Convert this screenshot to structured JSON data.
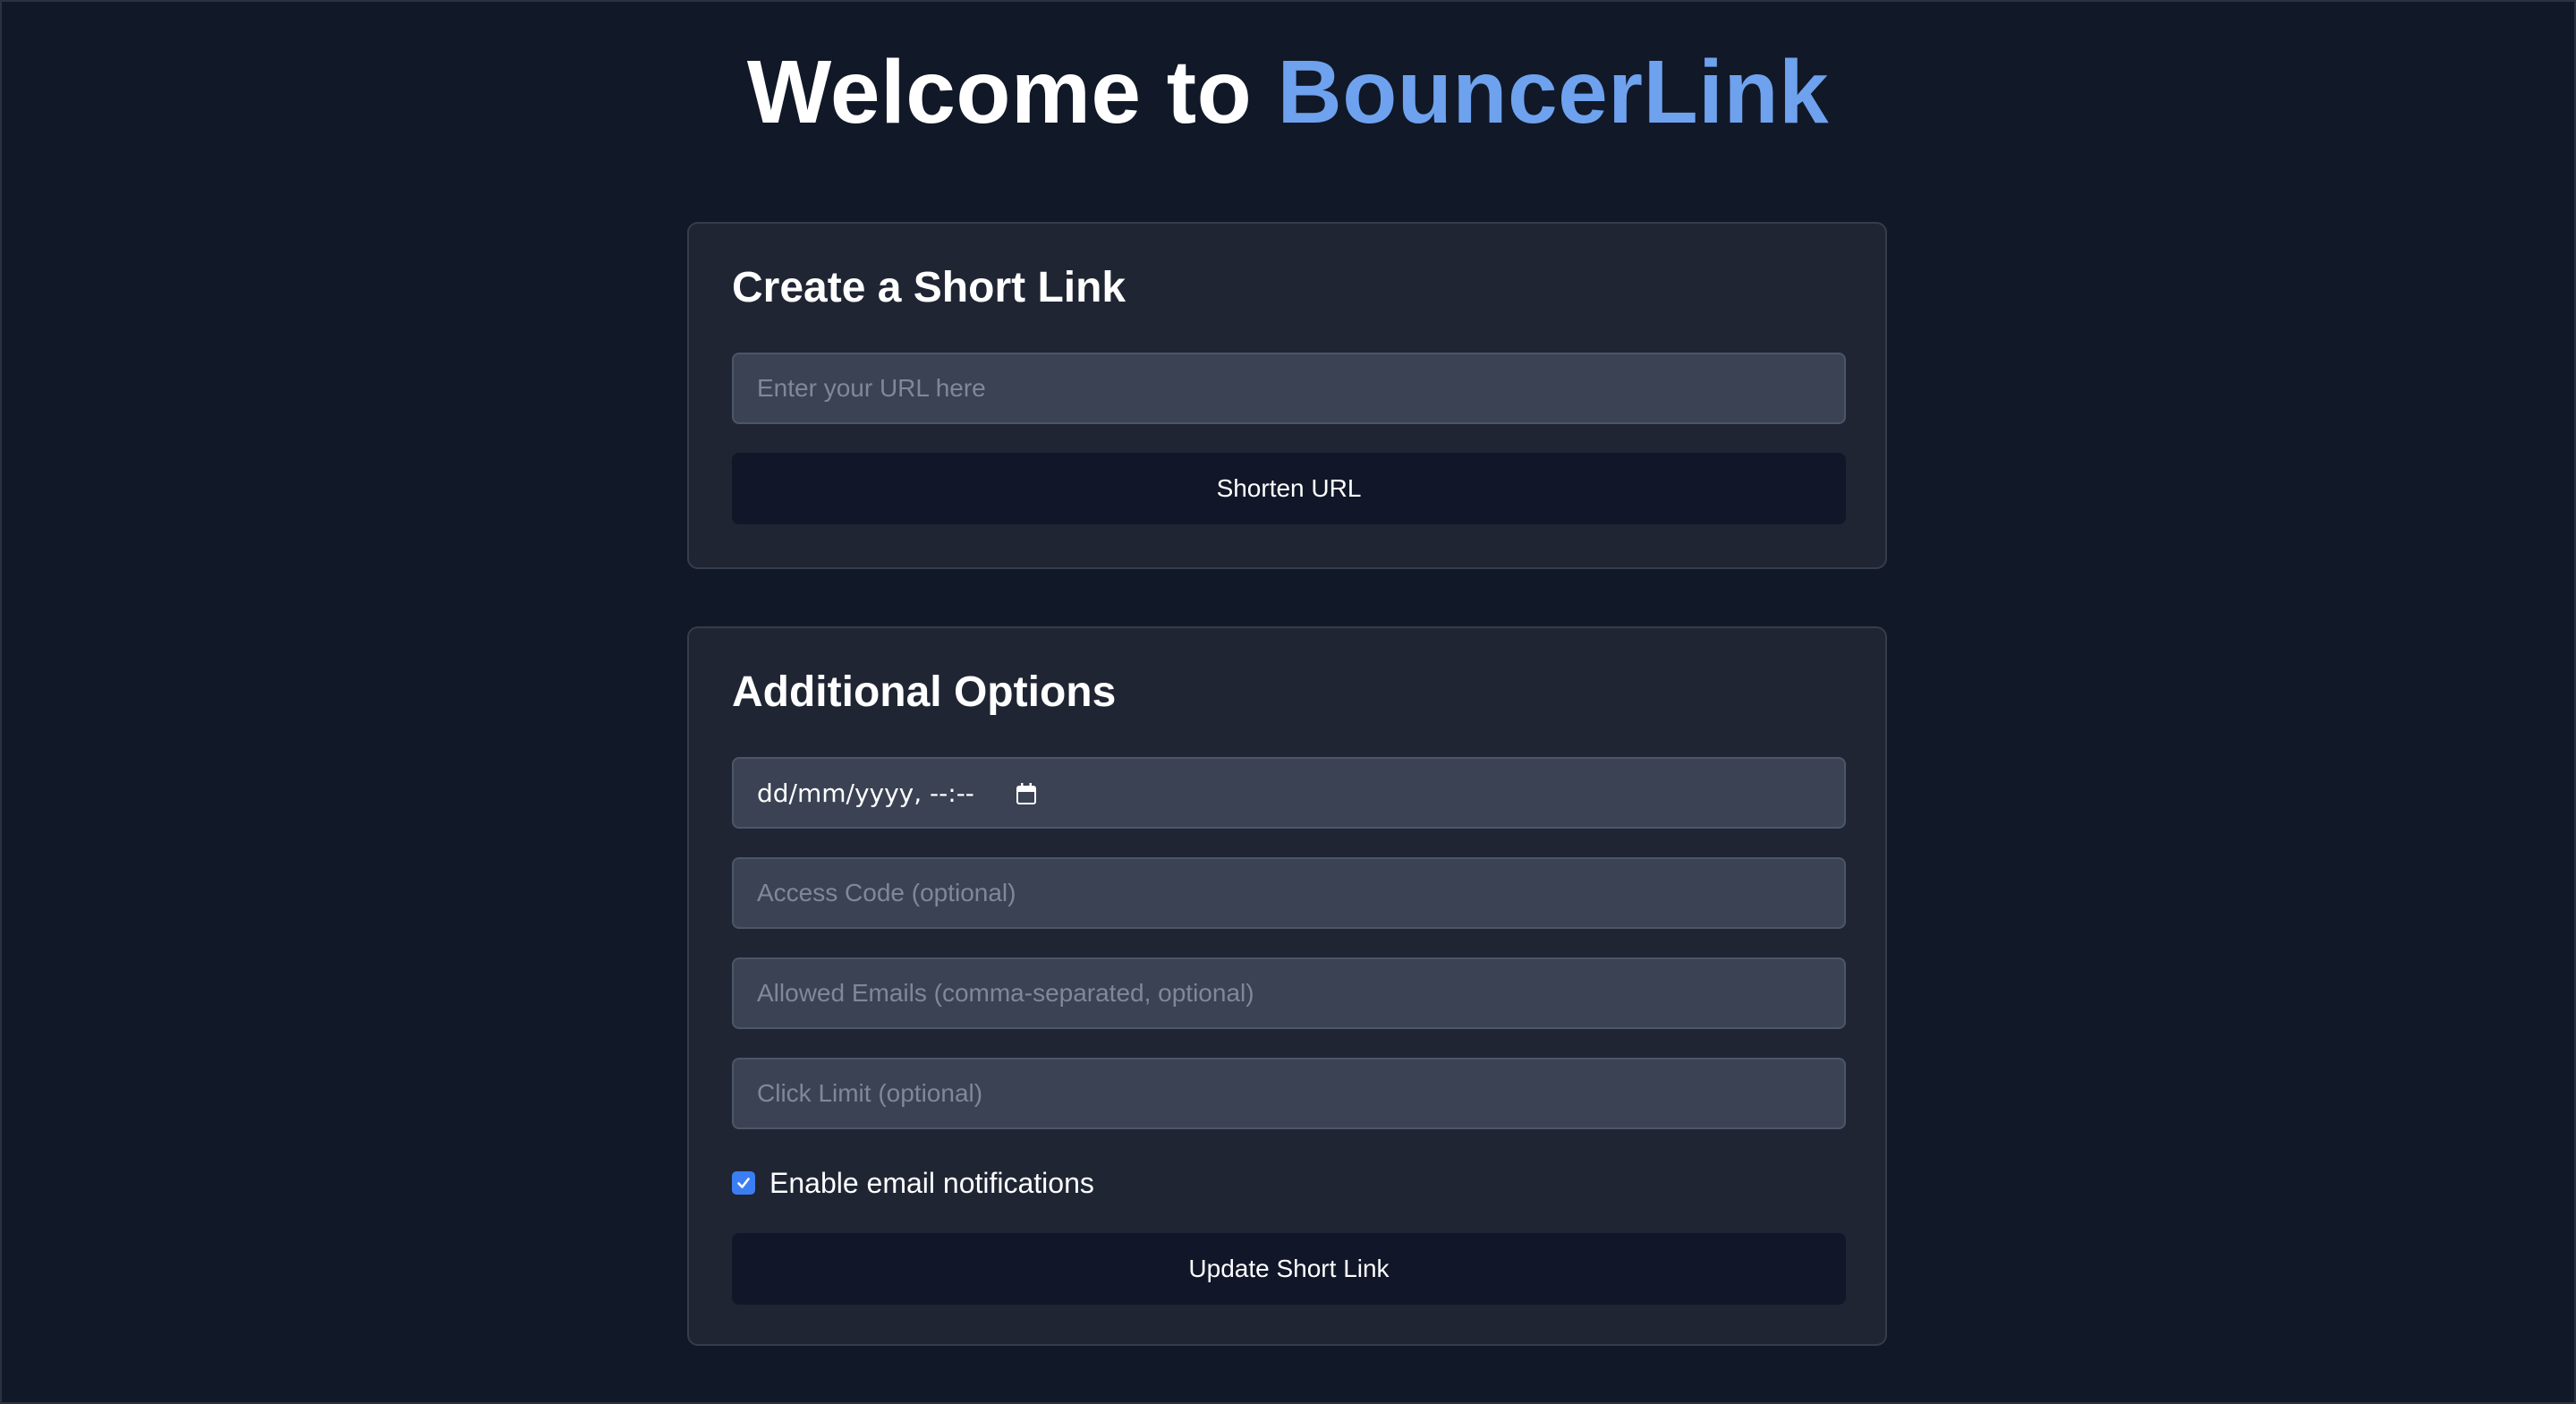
{
  "header": {
    "title_prefix": "Welcome to ",
    "brand": "BouncerLink"
  },
  "create_card": {
    "heading": "Create a Short Link",
    "url_input": {
      "placeholder": "Enter your URL here",
      "value": ""
    },
    "shorten_button": "Shorten URL"
  },
  "options_card": {
    "heading": "Additional Options",
    "expiry_input": {
      "display": "dd/mm/yyyy, --:--",
      "icon": "calendar-icon"
    },
    "access_code_input": {
      "placeholder": "Access Code (optional)",
      "value": ""
    },
    "allowed_emails_input": {
      "placeholder": "Allowed Emails (comma-separated, optional)",
      "value": ""
    },
    "click_limit_input": {
      "placeholder": "Click Limit (optional)",
      "value": ""
    },
    "email_notifications": {
      "label": "Enable email notifications",
      "checked": true
    },
    "update_button": "Update Short Link"
  },
  "colors": {
    "background": "#111827",
    "card": "#1f2533",
    "input": "#3a4254",
    "button": "#111729",
    "brand_accent": "#6ea2ee",
    "checkbox": "#3b7ef3"
  }
}
